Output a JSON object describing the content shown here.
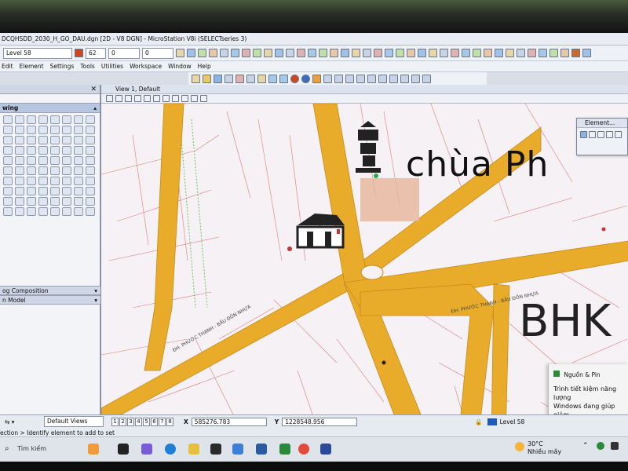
{
  "window": {
    "title": "DCQHSDD_2030_H_GO_DAU.dgn [2D - V8 DGN] - MicroStation V8i (SELECTseries 3)"
  },
  "toolbar": {
    "level": "Level 58",
    "color": "62",
    "weight": "0",
    "style": "0"
  },
  "menu": {
    "items": [
      "Edit",
      "Element",
      "Settings",
      "Tools",
      "Utilities",
      "Workspace",
      "Window",
      "Help"
    ]
  },
  "left_panel": {
    "title": "wing",
    "sections": [
      "og Composition",
      "n Model"
    ]
  },
  "view": {
    "title": "View 1, Default"
  },
  "map_labels": {
    "pagoda_text": "chùa  Ph",
    "bhk_text": "BHK",
    "road_label_1": "ĐH. PHƯỚC THẠNH - BẦU ĐỒN NHỰA",
    "road_label_2": "ĐH. PHƯỚC THẠNH - BẦU ĐỒN NHỰA"
  },
  "element_dialog": {
    "title": "Element..."
  },
  "notification": {
    "title": "Nguồn & Pin",
    "line1": "Trình tiết kiệm năng lượng",
    "line2": "Windows đang giúp giảm"
  },
  "statusbar": {
    "views_label": "Default Views",
    "view_numbers": [
      "1",
      "2",
      "3",
      "4",
      "5",
      "6",
      "7",
      "8"
    ],
    "x_label": "X",
    "x_value": "585276.783",
    "y_label": "Y",
    "y_value": "1228548.956",
    "level": "Level 58",
    "prompt": "ection > Identify element to add to set"
  },
  "taskbar": {
    "search_placeholder": "Tìm kiếm",
    "weather_temp": "30°C",
    "weather_desc": "Nhiều mây"
  },
  "colors": {
    "road": "#e9ac2a",
    "road_edge": "#c88a16",
    "lot_lines": "#e07a7a",
    "green_lines": "#5fc45f"
  }
}
